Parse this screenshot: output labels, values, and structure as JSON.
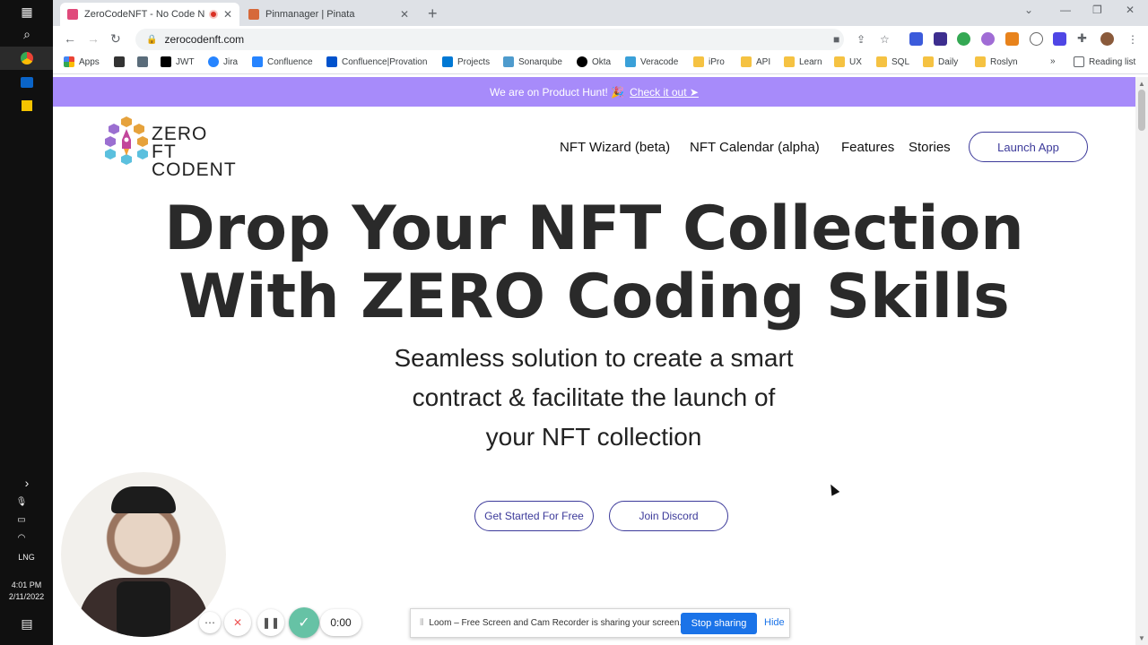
{
  "taskbar": {
    "language": "LNG",
    "time": "4:01 PM",
    "date": "2/11/2022"
  },
  "browser": {
    "tabs": [
      {
        "title": "ZeroCodeNFT - No Code NFT",
        "active": true,
        "favicon_color": "#e04a7b"
      },
      {
        "title": "Pinmanager | Pinata",
        "active": false,
        "favicon_color": "#d6693a"
      }
    ],
    "url": "zerocodenft.com",
    "bookmarks": [
      {
        "label": "Apps",
        "icon": "apps-grid-icon"
      },
      {
        "label": "",
        "icon": "bracket-icon"
      },
      {
        "label": "",
        "icon": "jenkins-icon"
      },
      {
        "label": "JWT",
        "icon": "jwt-icon"
      },
      {
        "label": "Jira",
        "icon": "jira-icon"
      },
      {
        "label": "Confluence",
        "icon": "confluence-icon"
      },
      {
        "label": "Confluence|Provation",
        "icon": "atlassian-icon"
      },
      {
        "label": "Projects",
        "icon": "azure-devops-icon"
      },
      {
        "label": "Sonarqube",
        "icon": "sonarqube-icon"
      },
      {
        "label": "Okta",
        "icon": "okta-icon"
      },
      {
        "label": "Veracode",
        "icon": "veracode-icon"
      },
      {
        "label": "iPro",
        "icon": "folder-icon"
      },
      {
        "label": "API",
        "icon": "folder-icon"
      },
      {
        "label": "Learn",
        "icon": "folder-icon"
      },
      {
        "label": "UX",
        "icon": "folder-icon"
      },
      {
        "label": "SQL",
        "icon": "folder-icon"
      },
      {
        "label": "Daily",
        "icon": "folder-icon"
      },
      {
        "label": "Roslyn",
        "icon": "folder-icon"
      }
    ],
    "overflow": "»",
    "reading_list": "Reading list"
  },
  "page": {
    "banner_text": "We are on Product Hunt! 🎉",
    "banner_link": "Check it out ➤",
    "logo_line1": "ZERO FT",
    "logo_line2": "CODENT",
    "nav": [
      "NFT Wizard (beta)",
      "NFT Calendar (alpha)",
      "Features",
      "Stories"
    ],
    "launch_app": "Launch App",
    "hero_line1": "Drop Your NFT Collection",
    "hero_line2": "With ZERO Coding Skills",
    "sub_line1": "Seamless solution to create a smart",
    "sub_line2": "contract & facilitate the launch of",
    "sub_line3": "your NFT collection",
    "cta_primary": "Get Started For Free",
    "cta_secondary": "Join Discord",
    "colors": {
      "banner": "#a78bfa",
      "accent": "#3c3a9a",
      "hero_text": "#2a2a2a"
    }
  },
  "loom": {
    "timer": "0:00",
    "share_message": "Loom – Free Screen and Cam Recorder is sharing your screen.",
    "stop_sharing": "Stop sharing",
    "hide": "Hide"
  }
}
